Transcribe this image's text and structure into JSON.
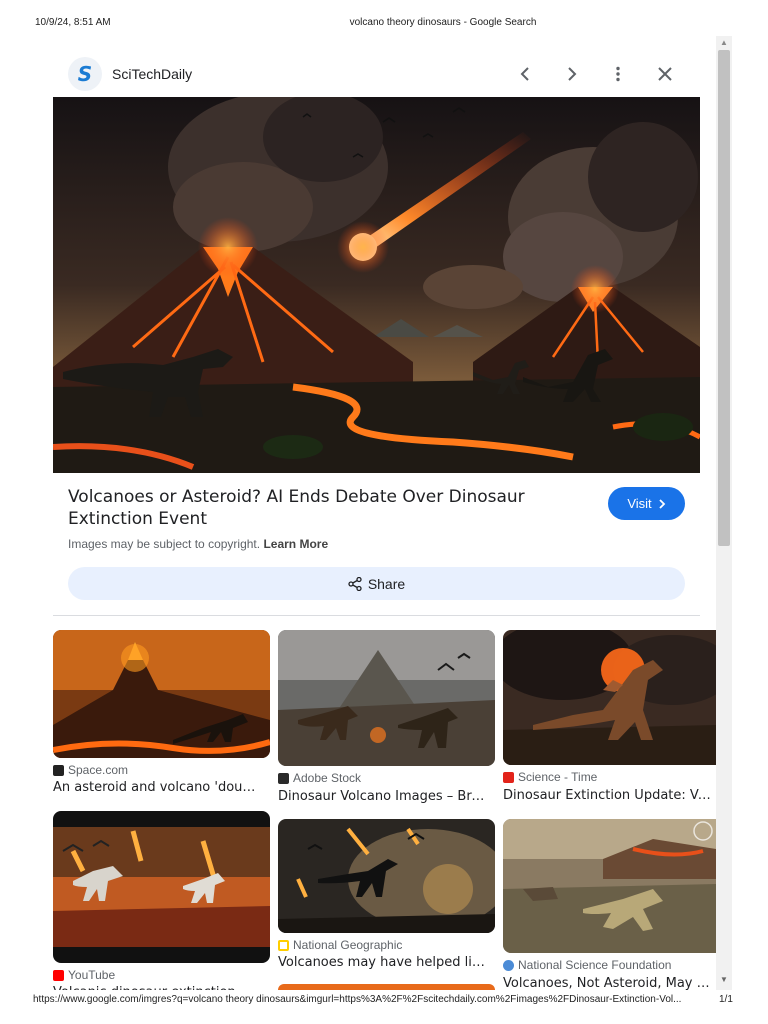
{
  "print": {
    "date": "10/9/24, 8:51 AM",
    "title": "volcano theory dinosaurs - Google Search",
    "url": "https://www.google.com/imgres?q=volcano theory dinosaurs&imgurl=https%3A%2F%2Fscitechdaily.com%2Fimages%2FDinosaur-Extinction-Vol...",
    "page": "1/1"
  },
  "source": {
    "logo_letter": "S",
    "name": "SciTechDaily"
  },
  "toolbar": {
    "icons": [
      "chevron-left-icon",
      "chevron-right-icon",
      "more-vert-icon",
      "close-icon"
    ]
  },
  "article": {
    "headline": "Volcanoes or Asteroid? AI Ends Debate Over Dinosaur Extinction Event",
    "visit_label": "Visit",
    "copyright_text": "Images may be subject to copyright.",
    "learn_more": "Learn More",
    "share_label": "Share"
  },
  "related": [
    {
      "source": "Space.com",
      "title": "An asteroid and volcano 'double…",
      "favicon_color": "#222222"
    },
    {
      "source": "Adobe Stock",
      "title": "Dinosaur Volcano Images – Bro…",
      "favicon_color": "#2a2a2a"
    },
    {
      "source": "Science - Time",
      "title": "Dinosaur Extinction Update: Vol…",
      "favicon_color": "#e2231a"
    },
    {
      "source": "YouTube",
      "title": "Volcanic dinosaur extinction…",
      "favicon_color": "#ff0000"
    },
    {
      "source": "National Geographic",
      "title": "Volcanoes may have helped life …",
      "favicon_color": "#ffce00"
    },
    {
      "source": "National Science Foundation",
      "title": "Volcanoes, Not Asteroid, May H…",
      "favicon_color": "#4b8bd6"
    }
  ],
  "colors": {
    "accent": "#1a73e8",
    "share_bg": "#e8f0fe"
  }
}
